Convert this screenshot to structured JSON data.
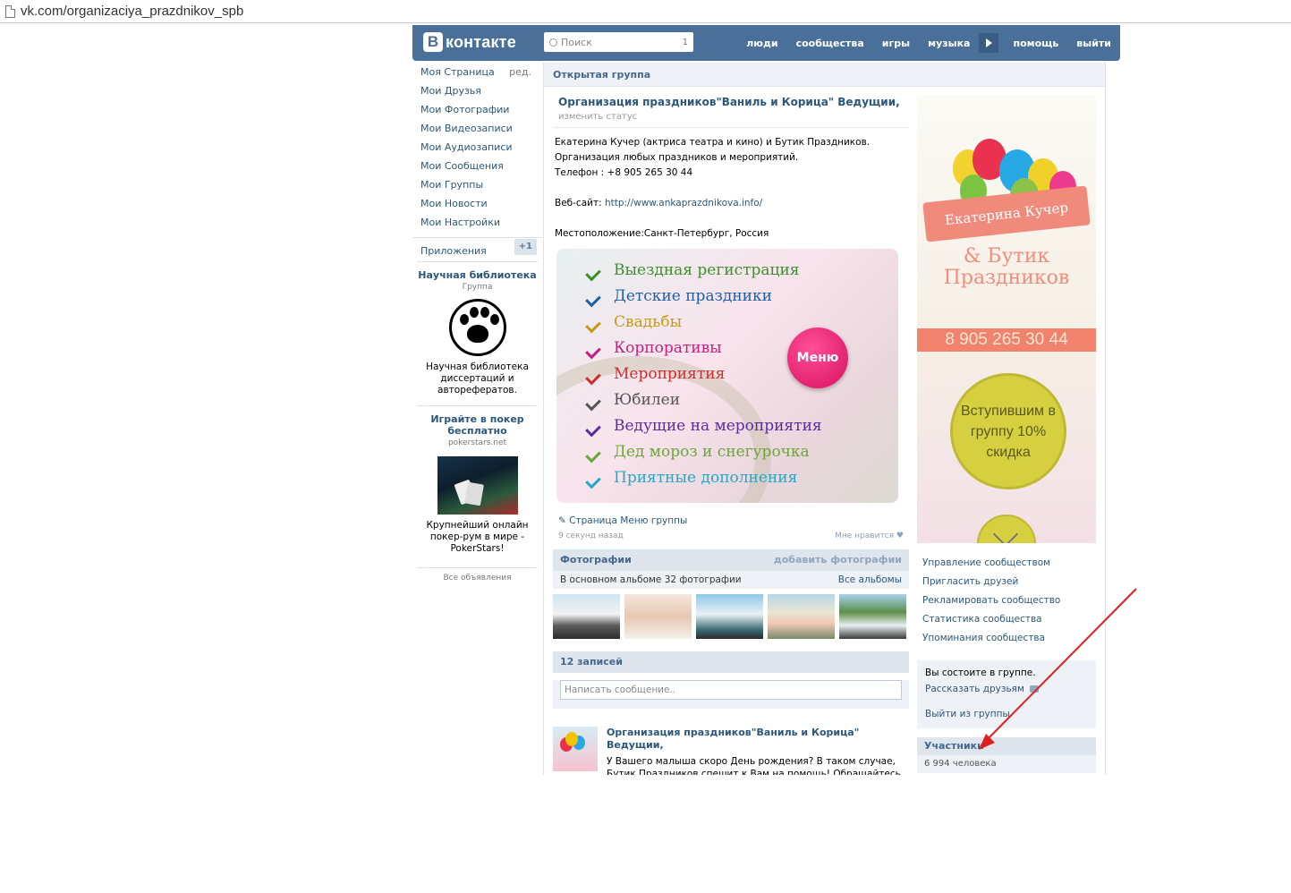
{
  "browser": {
    "url": "vk.com/organizaciya_prazdnikov_spb"
  },
  "header": {
    "logo_letter": "В",
    "logo_text": "контакте",
    "search_placeholder": "Поиск",
    "search_count": "1",
    "nav": [
      "люди",
      "сообщества",
      "игры",
      "музыка",
      "помощь",
      "выйти"
    ]
  },
  "sidebar": {
    "items": [
      {
        "label": "Моя Страница",
        "extra": "ред."
      },
      {
        "label": "Мои Друзья"
      },
      {
        "label": "Мои Фотографии"
      },
      {
        "label": "Мои Видеозаписи"
      },
      {
        "label": "Мои Аудиозаписи"
      },
      {
        "label": "Мои Сообщения"
      },
      {
        "label": "Мои Группы"
      },
      {
        "label": "Мои Новости"
      },
      {
        "label": "Мои Настройки"
      }
    ],
    "apps_label": "Приложения",
    "apps_badge": "+1",
    "ad1": {
      "title": "Научная библиотека",
      "subtitle": "Группа",
      "text": "Научная библиотека диссертаций и авторефератов."
    },
    "ad2": {
      "title": "Играйте в покер бесплатно",
      "subtitle": "pokerstars.net",
      "text": "Крупнейший онлайн покер-рум в мире - PokerStars!"
    },
    "all_ads": "Все объявления"
  },
  "main": {
    "open_group": "Открытая группа",
    "group_title": "Организация праздников\"Ваниль и Корица\" Ведущии,",
    "status": "изменить статус",
    "desc_lines": [
      "Екатерина Кучер (актриса театра и кино) и Бутик Праздников.",
      "Организация любых праздников и мероприятий.",
      "Телефон : +8 905 265 30 44"
    ],
    "website_label": "Веб-сайт:",
    "website_url": "http://www.ankaprazdnikova.info/",
    "location": "Местоположение:Санкт-Петербург, Россия",
    "menu_items": [
      {
        "label": "Выездная регистрация",
        "color": "#3f8f2f"
      },
      {
        "label": "Детские праздники",
        "color": "#1f5fa8"
      },
      {
        "label": "Свадьбы",
        "color": "#c79a16"
      },
      {
        "label": "Корпоративы",
        "color": "#c61f7f"
      },
      {
        "label": "Мероприятия",
        "color": "#d12c2c"
      },
      {
        "label": "Юбилеи",
        "color": "#555555"
      },
      {
        "label": "Ведущие на мероприятия",
        "color": "#5b2aa6"
      },
      {
        "label": "Дед мороз и снегурочка",
        "color": "#6aa63a"
      },
      {
        "label": "Приятные дополнения",
        "color": "#22a9c6"
      }
    ],
    "menu_button": "Меню",
    "page_link": "Страница Меню группы",
    "time_ago": "9 секунд назад",
    "like": "Мне нравится",
    "photos": {
      "title": "Фотографии",
      "add": "добавить фотографии",
      "subtitle": "В основном альбоме 32 фотографии",
      "all_albums": "Все альбомы"
    },
    "wall": {
      "title": "12 записей",
      "placeholder": "Написать сообщение..",
      "post_title": "Организация праздников\"Ваниль и Корица\" Ведущии,",
      "post_text_1": "У Вашего малыша скоро День рождения? В таком случае,",
      "post_text_2": "Бутик Праздников спешит к Вам на помощь! Обращайтесь к"
    }
  },
  "right": {
    "banner": {
      "ribbon": "Екатерина Кучер",
      "butik": "& Бутик Праздников",
      "phone": "8 905 265 30 44",
      "discount": "Вступившим в группу 10% скидка"
    },
    "admin_links": [
      "Управление сообществом",
      "Пригласить друзей",
      "Рекламировать сообщество",
      "Статистика сообщества",
      "Упоминания сообщества"
    ],
    "member_status": "Вы состоите в группе.",
    "tell_friends": "Рассказать друзьям",
    "leave": "Выйти из группы",
    "members_title": "Участники",
    "members_count": "6 994 человека"
  }
}
